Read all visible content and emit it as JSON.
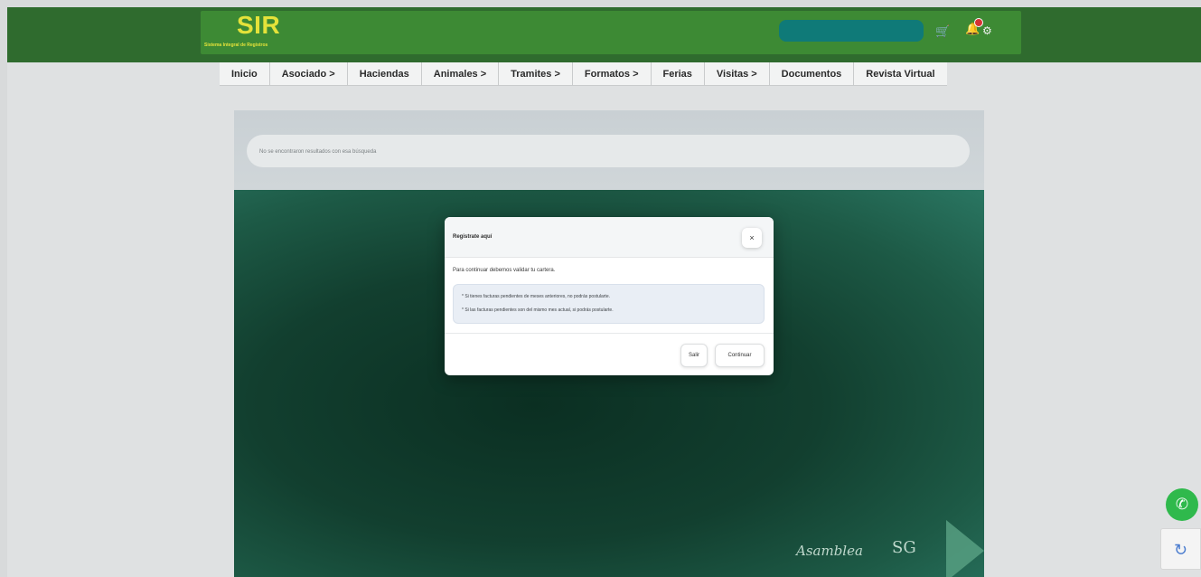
{
  "header": {
    "logo_title": "SIR",
    "logo_subtitle": "Sistema Integral de Registros",
    "icons": {
      "cart": "cart-icon",
      "notifications": "bell-icon",
      "settings": "gear-icon"
    },
    "colors": {
      "bar": "#2f6b2e",
      "inner": "#3d8a34",
      "logo": "#e4e23a",
      "search": "#0f7a78"
    }
  },
  "nav": {
    "items": [
      {
        "label": "Inicio"
      },
      {
        "label": "Asociado >"
      },
      {
        "label": "Haciendas"
      },
      {
        "label": "Animales >"
      },
      {
        "label": "Tramites >"
      },
      {
        "label": "Formatos >"
      },
      {
        "label": "Ferias"
      },
      {
        "label": "Visitas >"
      },
      {
        "label": "Documentos"
      },
      {
        "label": "Revista Virtual"
      }
    ]
  },
  "content": {
    "result_text": "No se encontraron resultados con esa búsqueda"
  },
  "modal": {
    "title": "Registrate aquí",
    "close_label": "×",
    "intro": "Para continuar debemos validar tu cartera.",
    "notes": [
      "* Si tienes facturas pendientes de meses anteriores, no podrás postularte.",
      "* Si las facturas pendientes son del mismo mes actual, si podrás postularte."
    ],
    "exit_label": "Salir",
    "continue_label": "Continuar"
  },
  "widgets": {
    "whatsapp": "whatsapp-icon",
    "recaptcha": "recaptcha-icon"
  }
}
